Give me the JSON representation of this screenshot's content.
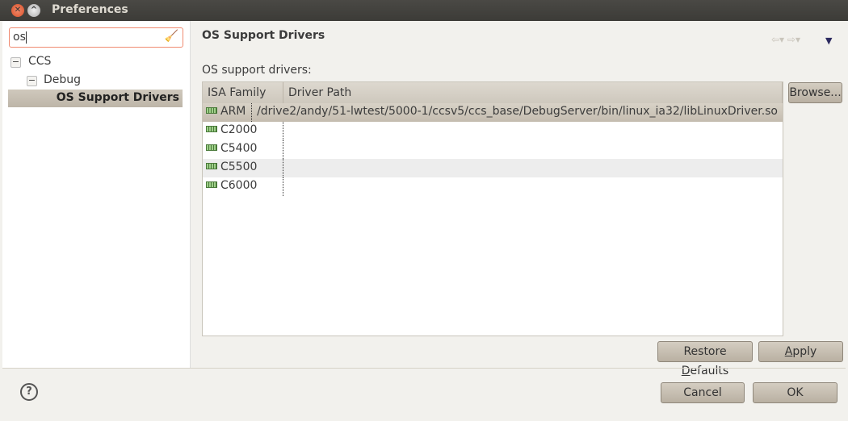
{
  "window": {
    "title": "Preferences"
  },
  "sidebar": {
    "search_value": "os",
    "tree": [
      {
        "label": "CCS"
      },
      {
        "label": "Debug"
      },
      {
        "label": "OS Support Drivers"
      }
    ]
  },
  "page": {
    "title": "OS Support Drivers",
    "section_label": "OS support drivers:",
    "columns": [
      "ISA Family",
      "Driver Path"
    ],
    "rows": [
      {
        "family": "ARM",
        "path": "/drive2/andy/51-lwtest/5000-1/ccsv5/ccs_base/DebugServer/bin/linux_ia32/libLinuxDriver.so"
      },
      {
        "family": "C2000",
        "path": ""
      },
      {
        "family": "C5400",
        "path": ""
      },
      {
        "family": "C5500",
        "path": ""
      },
      {
        "family": "C6000",
        "path": ""
      }
    ]
  },
  "buttons": {
    "browse": "Browse...",
    "restore_pre": "Restore ",
    "restore_u": "D",
    "restore_post": "efaults",
    "apply_u": "A",
    "apply_post": "pply",
    "cancel": "Cancel",
    "ok": "OK"
  }
}
